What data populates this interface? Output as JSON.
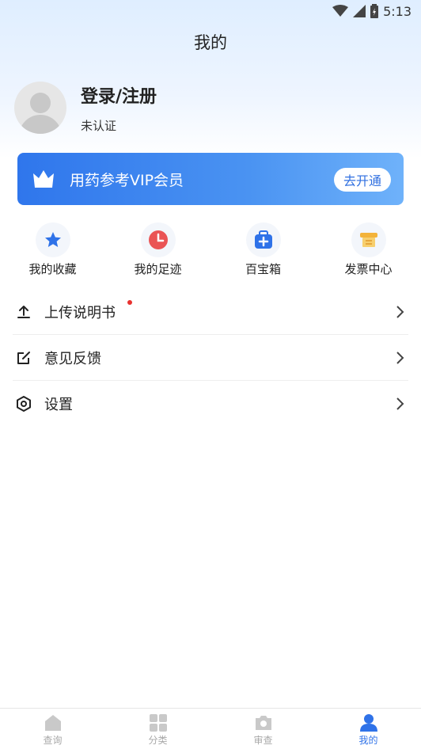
{
  "status_bar": {
    "time": "5:13",
    "icons": [
      "wifi-icon",
      "signal-icon",
      "battery-icon"
    ]
  },
  "header": {
    "title": "我的"
  },
  "profile": {
    "name": "登录/注册",
    "status": "未认证",
    "avatar_icon": "default-avatar-icon"
  },
  "vip": {
    "title": "用药参考VIP会员",
    "button": "去开通",
    "icon": "crown-icon"
  },
  "quick_actions": [
    {
      "label": "我的收藏",
      "icon": "star-icon",
      "color": "#2f72e8"
    },
    {
      "label": "我的足迹",
      "icon": "clock-icon",
      "color": "#ea5455"
    },
    {
      "label": "百宝箱",
      "icon": "toolbox-icon",
      "color": "#2f72e8"
    },
    {
      "label": "发票中心",
      "icon": "invoice-icon",
      "color": "#f3b33a"
    }
  ],
  "menu": [
    {
      "label": "上传说明书",
      "icon": "upload-icon",
      "badge": true
    },
    {
      "label": "意见反馈",
      "icon": "edit-icon",
      "badge": false
    },
    {
      "label": "设置",
      "icon": "settings-icon",
      "badge": false
    }
  ],
  "tabbar": [
    {
      "label": "查询",
      "icon": "home-icon",
      "active": false
    },
    {
      "label": "分类",
      "icon": "grid-icon",
      "active": false
    },
    {
      "label": "审查",
      "icon": "camera-icon",
      "active": false
    },
    {
      "label": "我的",
      "icon": "user-icon",
      "active": true
    }
  ],
  "colors": {
    "accent": "#2f72e8",
    "badge": "#e8322f"
  }
}
